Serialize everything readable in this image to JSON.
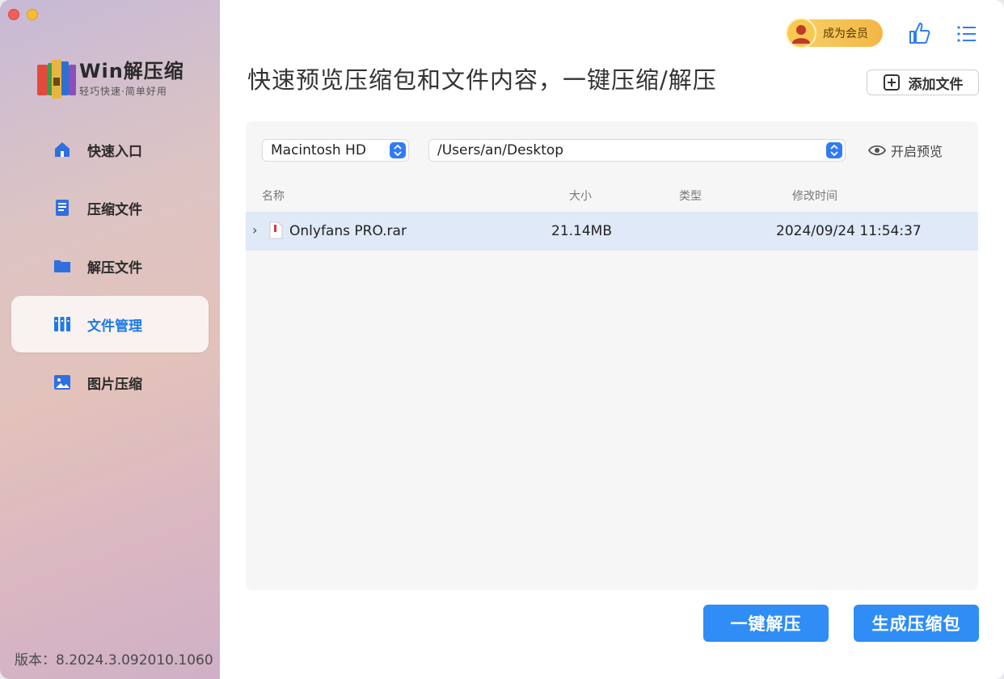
{
  "app": {
    "name": "Win解压缩",
    "tagline": "轻巧快速·简单好用"
  },
  "sidebar": {
    "items": [
      {
        "label": "快速入口",
        "icon": "home-icon",
        "active": false
      },
      {
        "label": "压缩文件",
        "icon": "compress-file-icon",
        "active": false
      },
      {
        "label": "解压文件",
        "icon": "folder-icon",
        "active": false
      },
      {
        "label": "文件管理",
        "icon": "file-manager-icon",
        "active": true
      },
      {
        "label": "图片压缩",
        "icon": "image-icon",
        "active": false
      }
    ],
    "version": "版本：8.2024.3.092010.1060"
  },
  "header": {
    "headline": "快速预览压缩包和文件内容，一键压缩/解压",
    "vip_label": "成为会员",
    "add_file_label": "添加文件"
  },
  "browser": {
    "drive": "Macintosh HD",
    "path": "/Users/an/Desktop",
    "preview_label": "开启预览",
    "columns": [
      "名称",
      "大小",
      "类型",
      "修改时间"
    ],
    "rows": [
      {
        "name": "Onlyfans PRO.rar",
        "size": "21.14MB",
        "type": "",
        "modified": "2024/09/24 11:54:37"
      }
    ]
  },
  "actions": {
    "extract_label": "一键解压",
    "create_archive_label": "生成压缩包"
  },
  "colors": {
    "accent": "#2f8df5",
    "selected_row": "#dfe9f7",
    "vip_gold": "#f3b644"
  }
}
